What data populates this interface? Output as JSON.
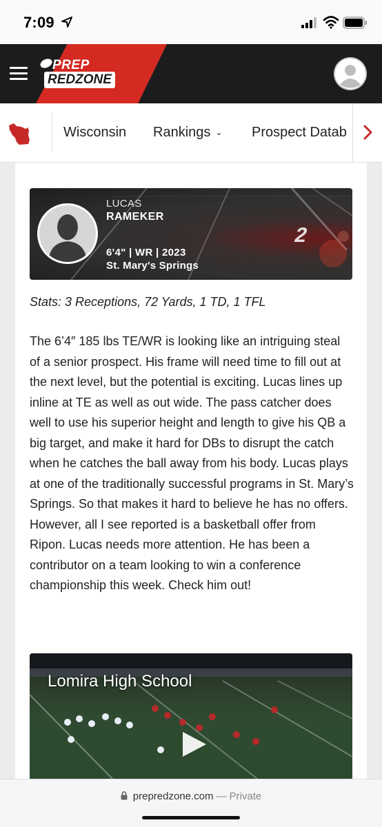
{
  "status_bar": {
    "time": "7:09"
  },
  "header": {
    "logo_top": "PREP",
    "logo_bottom": "REDZONE"
  },
  "nav": {
    "items": [
      "Wisconsin",
      "Rankings",
      "Prospect Datab"
    ],
    "rankings_chevron": "⌄"
  },
  "player": {
    "first_name": "LUCAS",
    "last_name": "RAMEKER",
    "meta": "6'4\" | WR | 2023",
    "school": "St. Mary's Springs",
    "jersey_number": "2"
  },
  "article": {
    "stats": "Stats: 3 Receptions, 72 Yards, 1 TD, 1 TFL",
    "body": "The 6’4″ 185 lbs TE/WR is looking like an intriguing steal of a senior prospect. His frame will need time to fill out at the next level, but the potential is exciting. Lucas lines up inline at TE as well as out wide. The pass catcher does well to use his superior height and length to give his QB a big target, and make it hard for DBs to disrupt the catch when he catches the ball away from his body. Lucas plays at one of the traditionally successful programs in St. Mary’s Springs. So that makes it hard to believe he has no offers. However, all I see reported is a basketball offer from Ripon. Lucas needs more attention. He has been a contributor on a team looking to win a conference championship this week. Check him out!"
  },
  "video": {
    "title": "Lomira High School"
  },
  "browser": {
    "url": "prepredzone.com",
    "separator": "—",
    "mode": "Private"
  },
  "colors": {
    "brand_red": "#d42a22",
    "header_bg": "#1c1c1e"
  },
  "icons": [
    "location-arrow-icon",
    "signal-icon",
    "wifi-icon",
    "battery-icon",
    "hamburger-menu-icon",
    "user-avatar-icon",
    "wisconsin-map-icon",
    "chevron-right-icon",
    "play-icon",
    "lock-icon"
  ]
}
